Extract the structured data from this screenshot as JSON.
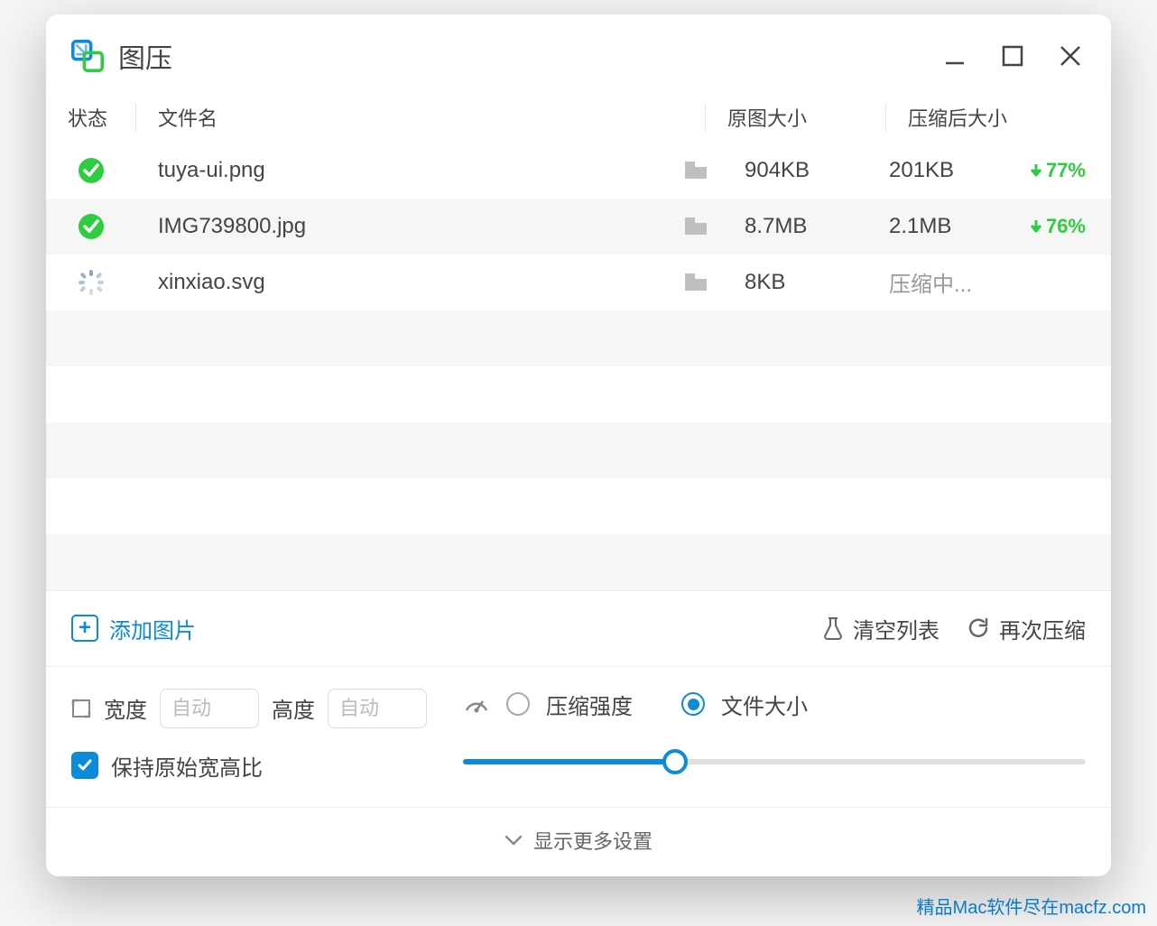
{
  "app": {
    "title": "图压"
  },
  "columns": {
    "status": "状态",
    "filename": "文件名",
    "original_size": "原图大小",
    "compressed_size": "压缩后大小"
  },
  "files": [
    {
      "status": "done",
      "name": "tuya-ui.png",
      "original": "904KB",
      "compressed": "201KB",
      "reduction": "77%"
    },
    {
      "status": "done",
      "name": "IMG739800.jpg",
      "original": "8.7MB",
      "compressed": "2.1MB",
      "reduction": "76%"
    },
    {
      "status": "processing",
      "name": "xinxiao.svg",
      "original": "8KB",
      "compressed": "压缩中...",
      "reduction": ""
    }
  ],
  "toolbar": {
    "add_image": "添加图片",
    "clear_list": "清空列表",
    "recompress": "再次压缩"
  },
  "settings": {
    "width_label": "宽度",
    "width_placeholder": "自动",
    "height_label": "高度",
    "height_placeholder": "自动",
    "keep_aspect": "保持原始宽高比",
    "compress_strength": "压缩强度",
    "file_size": "文件大小",
    "slider_percent": 34
  },
  "footer": {
    "show_more": "显示更多设置"
  },
  "watermark": "精品Mac软件尽在macfz.com"
}
